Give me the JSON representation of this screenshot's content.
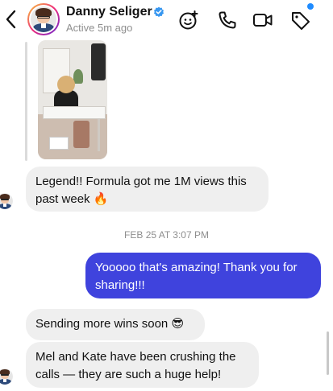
{
  "header": {
    "name": "Danny Seliger",
    "status": "Active 5m ago",
    "icons": {
      "back": "chevron-left-icon",
      "verified": "verified-badge-icon",
      "effects": "sticker-effects-icon",
      "call": "phone-icon",
      "video": "video-icon",
      "tag": "tag-icon"
    },
    "colors": {
      "verified": "#3897f0",
      "tag_dot": "#1f8bff"
    }
  },
  "messages": {
    "m1": {
      "text": "Legend!! Formula got me 1M views this past week",
      "emoji": "🔥"
    },
    "timestamp": "FEB 25 AT 3:07 PM",
    "m2": {
      "text": "Yooooo that's amazing! Thank you for sharing!!!"
    },
    "m3": {
      "text": "Sending more wins soon",
      "emoji": "😎"
    },
    "m4": {
      "text": "Mel and Kate have been crushing the calls — they are such a huge help!"
    }
  },
  "colors": {
    "incoming_bubble": "#efefef",
    "outgoing_bubble": "#3f43dd",
    "accent": "#3f43dd"
  }
}
